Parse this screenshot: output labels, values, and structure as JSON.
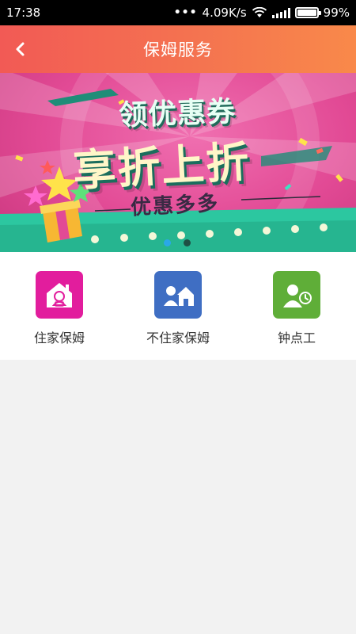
{
  "status_bar": {
    "time": "17:38",
    "network_speed": "4.09K/s",
    "battery_percent": "99%",
    "icons": [
      "wifi-icon",
      "signal-icon",
      "battery-icon"
    ]
  },
  "header": {
    "title": "保姆服务",
    "back_icon": "chevron-left-icon",
    "gradient": [
      "#f25a55",
      "#f9894a"
    ]
  },
  "banner": {
    "line1": "领优惠券",
    "line2": "享折上折",
    "line3": "优惠多多",
    "page_count": 2,
    "active_page": 0
  },
  "services": [
    {
      "label": "住家保姆",
      "icon": "home-nanny-icon",
      "color": "#e21d9d"
    },
    {
      "label": "不住家保姆",
      "icon": "visiting-nanny-icon",
      "color": "#3f6ec3"
    },
    {
      "label": "钟点工",
      "icon": "hourly-worker-icon",
      "color": "#5fae38"
    }
  ]
}
